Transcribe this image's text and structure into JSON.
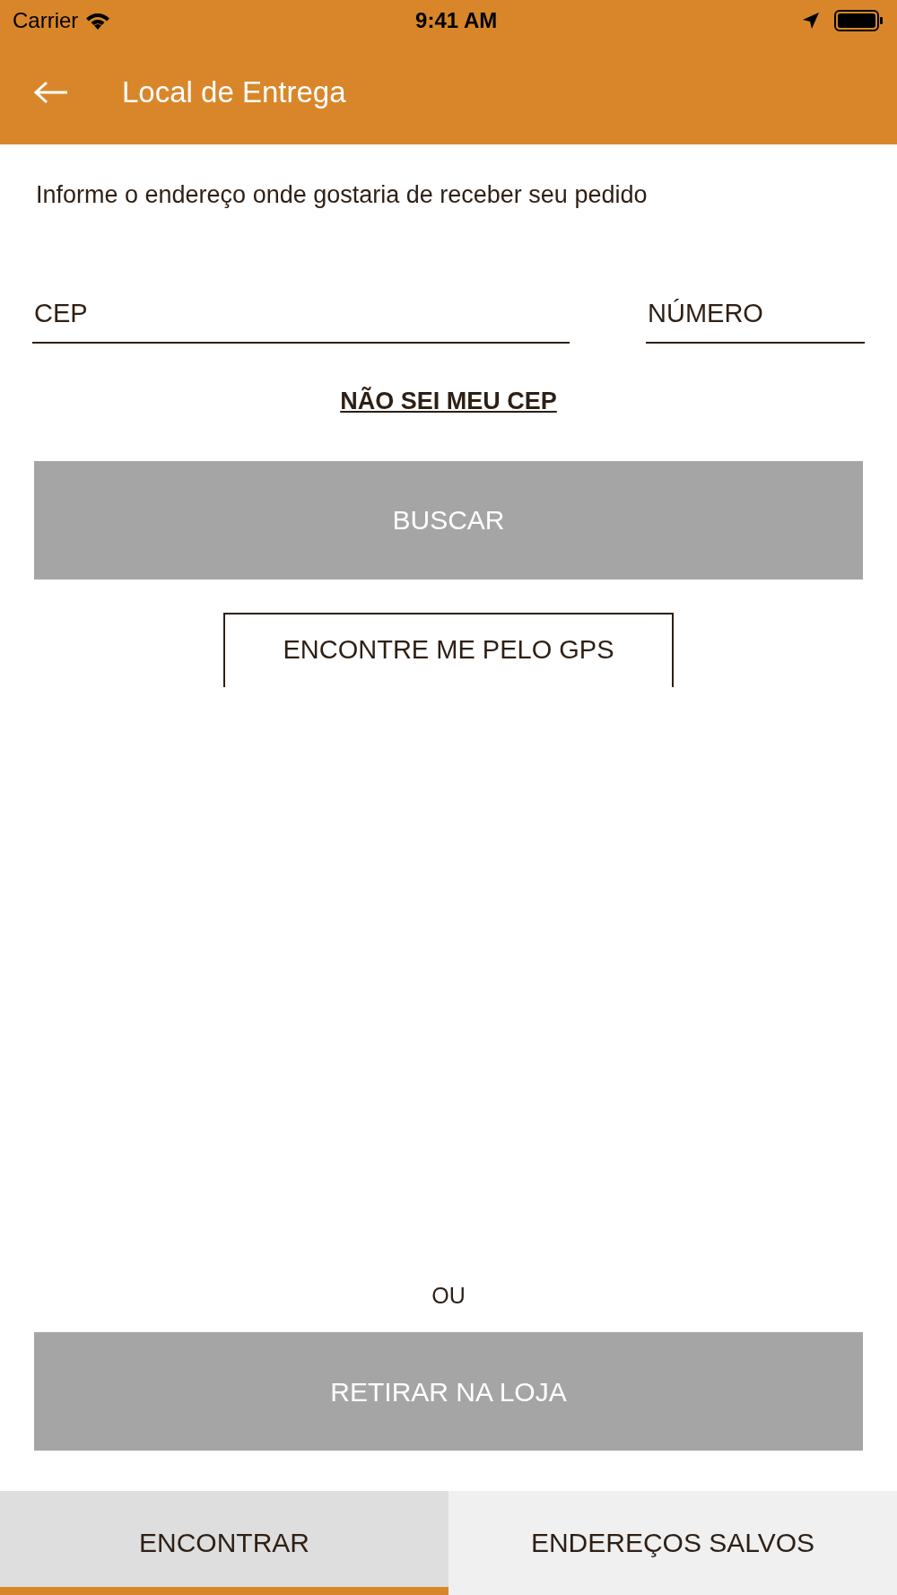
{
  "status_bar": {
    "carrier": "Carrier",
    "time": "9:41 AM"
  },
  "header": {
    "title": "Local de Entrega"
  },
  "instruction": "Informe o endereço onde gostaria de receber seu pedido",
  "fields": [
    {
      "placeholder": "CEP"
    },
    {
      "placeholder": "NÚMERO"
    }
  ],
  "cep_link": "NÃO SEI MEU CEP",
  "search_button": {
    "label": "BUSCAR",
    "disabled": true
  },
  "gps_button": {
    "label": "ENCONTRE ME PELO GPS"
  },
  "separator": "OU",
  "pickup_button": {
    "label": "RETIRAR NA LOJA",
    "disabled": true
  },
  "tabs": [
    {
      "label": "ENCONTRAR",
      "selected": true
    },
    {
      "label": "ENDEREÇOS SALVOS",
      "selected": false
    }
  ]
}
